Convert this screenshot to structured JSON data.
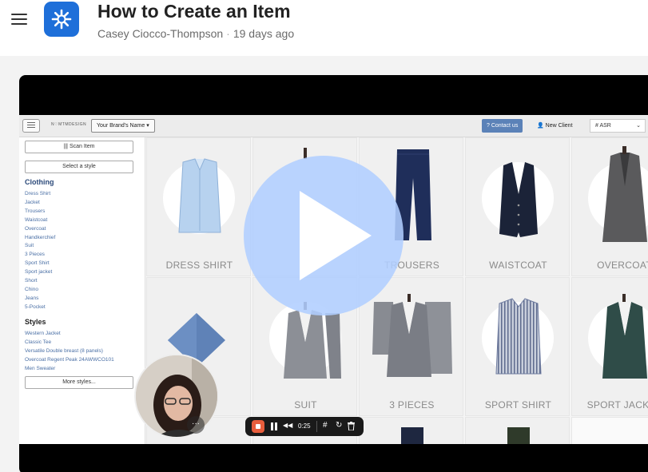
{
  "header": {
    "title": "How to Create an Item",
    "author": "Casey Ciocco-Thompson",
    "separator": "·",
    "age": "19 days ago"
  },
  "app": {
    "logo_text": "N♡MTMDESIGN",
    "brand_select": "Your Brand's Name",
    "contact_button": "Contact us",
    "new_client_button": "New Client",
    "search_value": "# ASR",
    "sidebar": {
      "scan_button": "Scan Item",
      "style_button": "Select a style",
      "clothing_heading": "Clothing",
      "clothing_items": [
        "Dress Shirt",
        "Jacket",
        "Trousers",
        "Waistcoat",
        "Overcoat",
        "Handkerchief",
        "Suit",
        "3 Pieces",
        "Sport Shirt",
        "Sport jacket",
        "Short",
        "Chino",
        "Jeans",
        "5-Pocket"
      ],
      "styles_heading": "Styles",
      "style_items": [
        "Western Jacket",
        "Classic Tee",
        "Versatile Double breast (8 panels)",
        "Overcoat Regent Peak 24AWWCO101",
        "Men Sweater"
      ],
      "more_styles_button": "More styles..."
    },
    "tiles": {
      "dress_shirt": "DRESS SHIRT",
      "trousers": "TROUSERS",
      "waistcoat": "WAISTCOAT",
      "overcoat": "OVERCOAT",
      "suit": "SUIT",
      "three_pieces": "3 PIECES",
      "sport_shirt": "SPORT SHIRT",
      "sport_jacket": "SPORT JACKET"
    }
  },
  "player": {
    "elapsed_time": "0:25",
    "cam_menu": "···"
  },
  "colors": {
    "brand_blue": "#1e6fd9",
    "play_overlay": "#b0ceff",
    "record_red": "#e85d3c",
    "link_blue": "#4a6fa5"
  },
  "icons": {
    "menu": "hamburger-icon",
    "logo": "snowflake-logo-icon",
    "play": "play-icon"
  }
}
